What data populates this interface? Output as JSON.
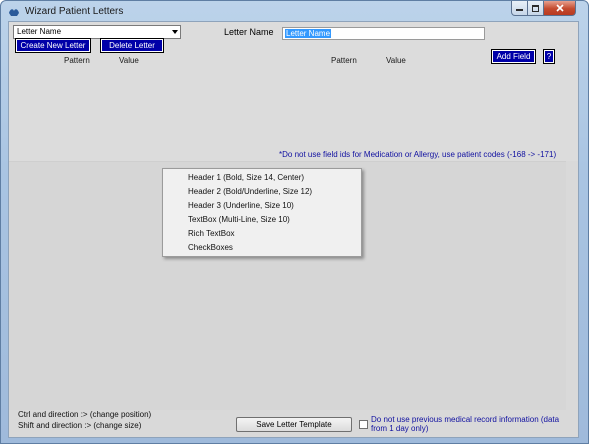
{
  "window": {
    "title": "Wizard Patient Letters"
  },
  "form": {
    "letter_select_value": "Letter Name",
    "create_button": "Create New Letter",
    "delete_button": "Delete Letter",
    "letter_name_label": "Letter Name",
    "letter_name_value": "Letter Name",
    "add_field_button": "Add Field",
    "help_button": "?",
    "columns": [
      "Pattern",
      "Value",
      "Pattern",
      "Value"
    ],
    "warning": "*Do not use field ids for Medication or Allergy, use patient codes (-168 -> -171)"
  },
  "context_menu": {
    "items": [
      "Header 1 (Bold, Size 14, Center)",
      "Header 2 (Bold/Underline, Size 12)",
      "Header 3 (Underline, Size 10)",
      "TextBox (Multi-Line, Size 10)",
      "Rich TextBox",
      "CheckBoxes"
    ]
  },
  "footer": {
    "hint_position": "Ctrl and direction :> (change position)",
    "hint_size": "Shift and direction :> (change size)",
    "save_button": "Save Letter Template",
    "prev_record_label": "Do not use previous medical record information (data from 1 day only)",
    "prev_record_checked": false
  },
  "colors": {
    "accent_button": "#0000a8",
    "warning_text": "#1010a0",
    "close_button": "#c44a2e"
  }
}
